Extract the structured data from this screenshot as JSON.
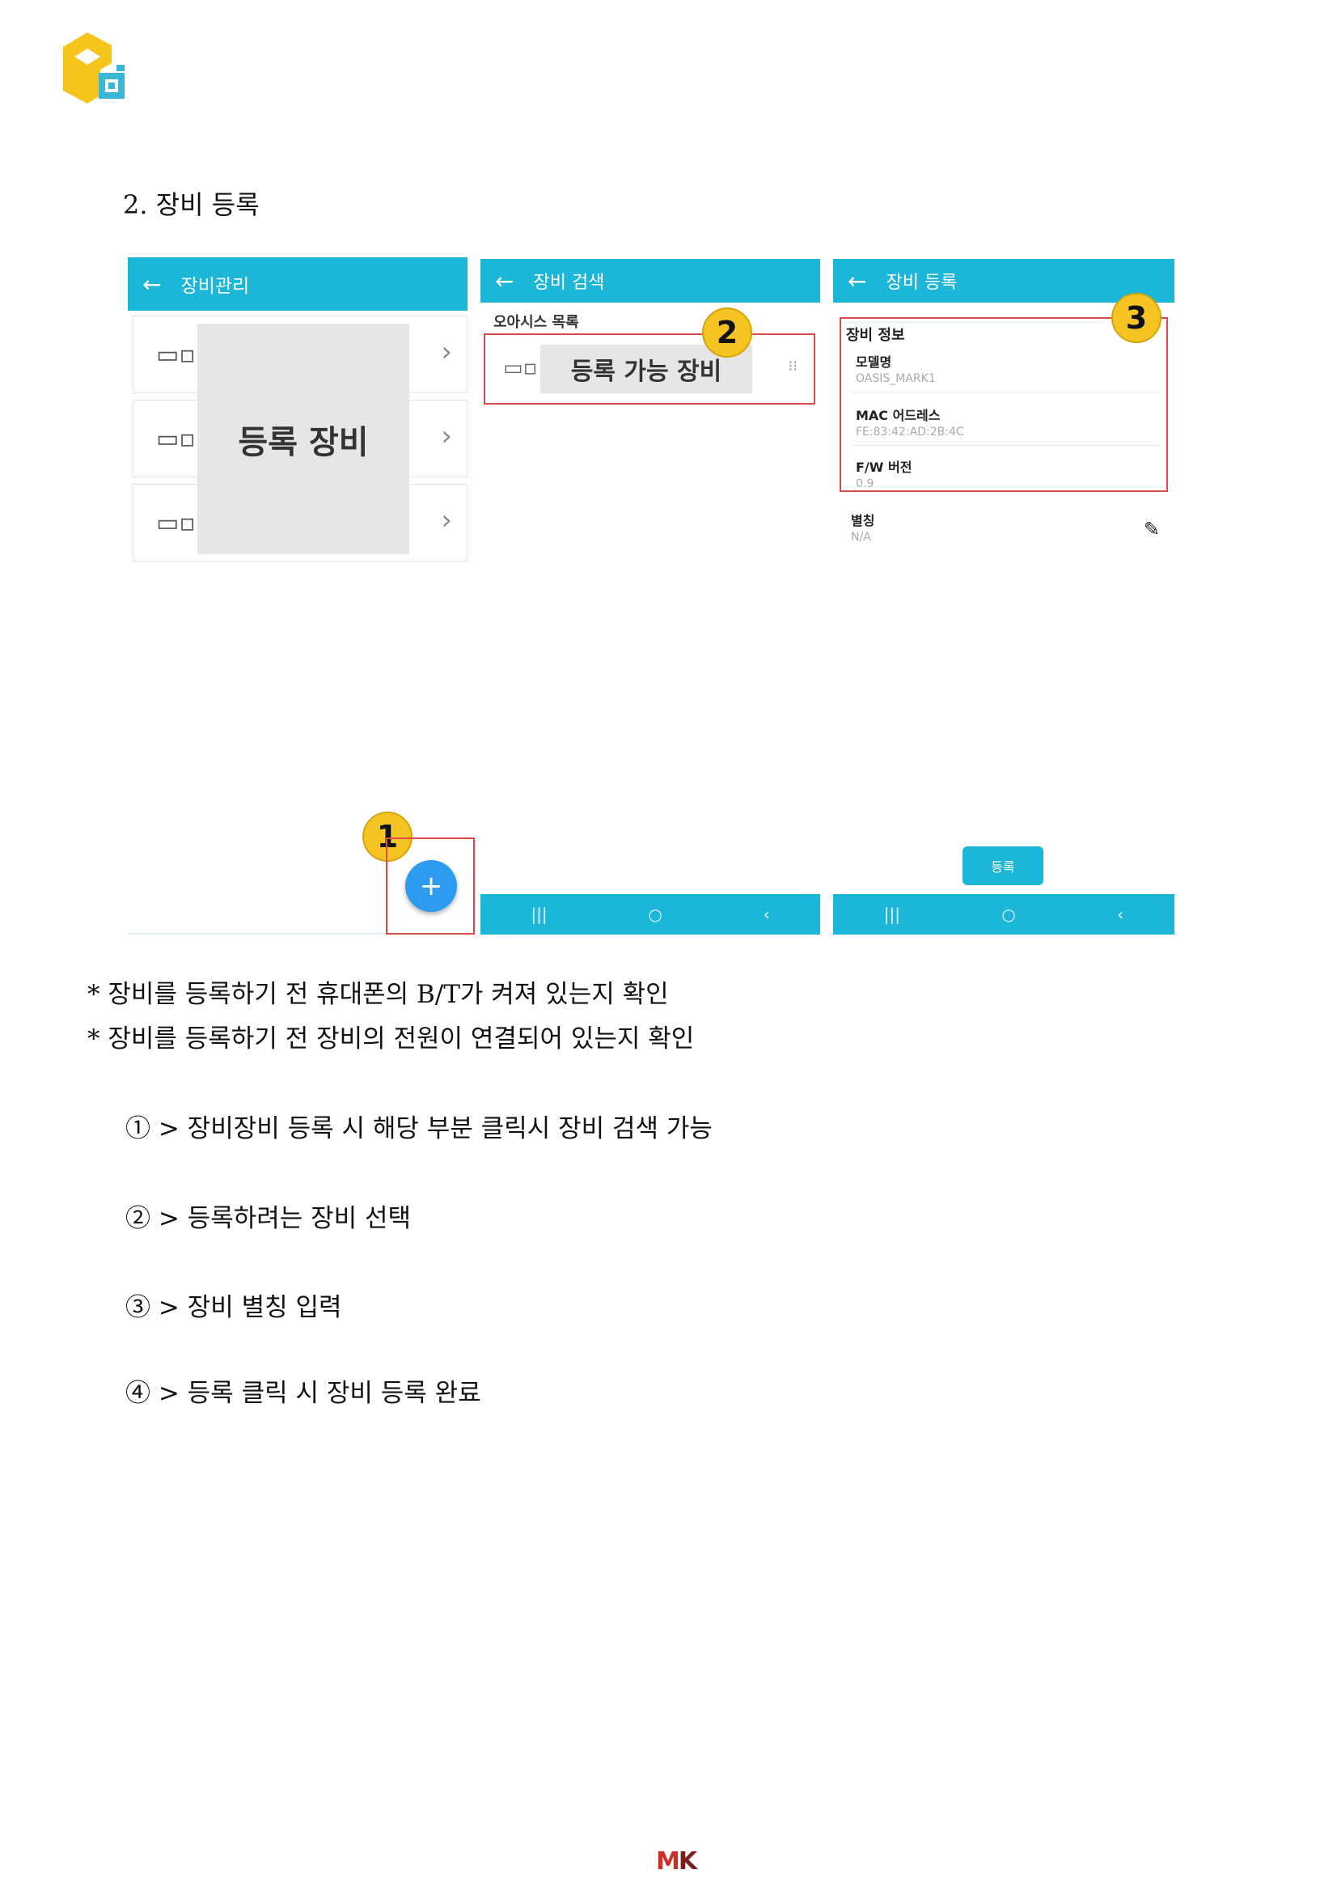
{
  "section_heading": "2. 장비 등록",
  "panel1": {
    "title": "장비관리",
    "back_icon": "←",
    "overlay_label": "등록 장비",
    "rows": [
      {
        "icon": "devices-icon",
        "chevron": "›"
      },
      {
        "icon": "devices-icon",
        "chevron": "›"
      },
      {
        "icon": "devices-icon",
        "chevron": "›"
      }
    ]
  },
  "panel2": {
    "title": "장비 검색",
    "back_icon": "←",
    "list_label": "오아시스 목록",
    "item_label": "등록 가능 장비",
    "signal_icon": "⁝⁝"
  },
  "panel3": {
    "title": "장비 등록",
    "back_icon": "←",
    "section": "장비 정보",
    "model_label": "모델명",
    "model_value": "OASIS_MARK1",
    "mac_label": "MAC 어드레스",
    "mac_value": "FE:83:42:AD:2B:4C",
    "fw_label": "F/W 버전",
    "fw_value": "0.9",
    "alias_label": "별칭",
    "alias_value": "N/A",
    "register_button": "등록"
  },
  "badges": [
    "1",
    "2",
    "3"
  ],
  "fab_label": "+",
  "navbar": {
    "recent": "|||",
    "home": "○",
    "back": "‹"
  },
  "notes": [
    "* 장비를 등록하기 전 휴대폰의 B/T가 켜져 있는지 확인",
    "* 장비를 등록하기 전 장비의 전원이 연결되어 있는지 확인"
  ],
  "steps": [
    "① > 장비장비 등록 시 해당 부분 클릭시 장비 검색 가능",
    "② > 등록하려는 장비 선택",
    "③ > 장비 별칭 입력",
    "④ > 등록 클릭 시 장비 등록 완료"
  ],
  "footer_logo": {
    "m": "M",
    "k": "K"
  },
  "colors": {
    "accent": "#1cb6d9",
    "highlight": "#d84b4b",
    "badge": "#f5c423",
    "fab": "#2d9cf0"
  }
}
